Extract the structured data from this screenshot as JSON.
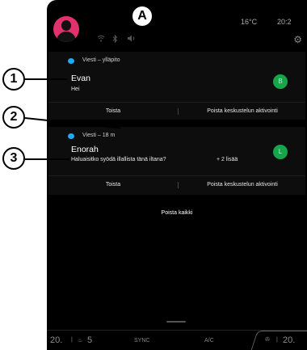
{
  "callouts": {
    "top": "A",
    "one": "1",
    "two": "2",
    "three": "3"
  },
  "status": {
    "temperature": "16°C",
    "time": "20:2"
  },
  "notifications": [
    {
      "sender": "Viesti – ylläpito",
      "name": "Evan",
      "message": "Hei",
      "avatar_letter": "B",
      "actions": [
        "Toista",
        "Poista keskustelun aktivointi"
      ]
    },
    {
      "sender": "Viesti – 18 m",
      "name": "Enorah",
      "message": "Haluaisitko syödä illallista tänä iltana?",
      "more": "+ 2 lisää",
      "avatar_letter": "L",
      "actions": [
        "Toista",
        "Poista keskustelun aktivointi"
      ]
    }
  ],
  "clear_all": "Poista kaikki",
  "climate": {
    "left_temp": "20.",
    "fan_level": "5",
    "sync": "SYNC",
    "ac": "A/C",
    "right_temp": "20."
  },
  "colors": {
    "notification_dot": "#23a9f0",
    "avatar_bg": "#e0336e",
    "badge_bg": "#17a54c"
  },
  "icons": [
    "wifi-icon",
    "bluetooth-icon",
    "volume-icon",
    "settings-icon",
    "seat-heat-icon",
    "fan-icon"
  ]
}
